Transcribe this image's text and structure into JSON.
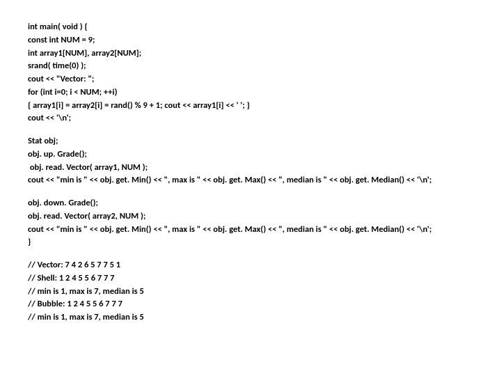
{
  "lines": [
    "int main( void ) {",
    "const int NUM = 9;",
    "int array1[NUM], array2[NUM];",
    "srand( time(0) );",
    "cout << \"Vector: \";",
    "for (int i=0; i < NUM; ++i)",
    "{ array1[i] = array2[i] = rand() % 9 + 1; cout << array1[i] << ' '; }",
    "cout << '\\n';",
    "",
    "Stat obj;",
    "obj. up. Grade();",
    " obj. read. Vector( array1, NUM );",
    "cout << \"min is \" << obj. get. Min() << \", max is \" << obj. get. Max() << \", median is \" << obj. get. Median() << '\\n';",
    "",
    "obj. down. Grade();",
    "obj. read. Vector( array2, NUM );",
    "cout << \"min is \" << obj. get. Min() << \", max is \" << obj. get. Max() << \", median is \" << obj. get. Median() << '\\n';",
    "}",
    "",
    "// Vector: 7 4 2 6 5 7 7 5 1",
    "// Shell: 1 2 4 5 5 6 7 7 7",
    "// min is 1, max is 7, median is 5",
    "// Bubble: 1 2 4 5 5 6 7 7 7",
    "// min is 1, max is 7, median is 5"
  ]
}
